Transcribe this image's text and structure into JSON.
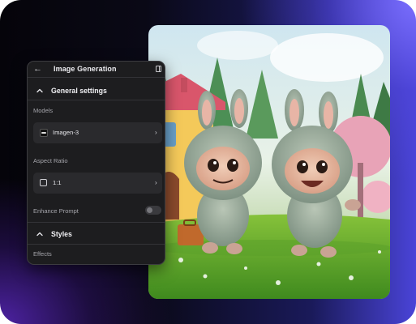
{
  "panel": {
    "title": "Image Generation",
    "back_icon": "arrow-left-icon",
    "dock_icon": "panel-right-icon",
    "sections": {
      "general": "General settings",
      "styles": "Styles"
    },
    "models": {
      "label": "Models",
      "value": "Imagen-3"
    },
    "aspect_ratio": {
      "label": "Aspect Ratio",
      "value": "1:1"
    },
    "enhance_prompt": {
      "label": "Enhance Prompt",
      "enabled": false
    },
    "effects": {
      "label": "Effects"
    }
  },
  "colors": {
    "panel_bg": "#1d1d1f",
    "accent_gradient_end": "#5b55f0"
  }
}
